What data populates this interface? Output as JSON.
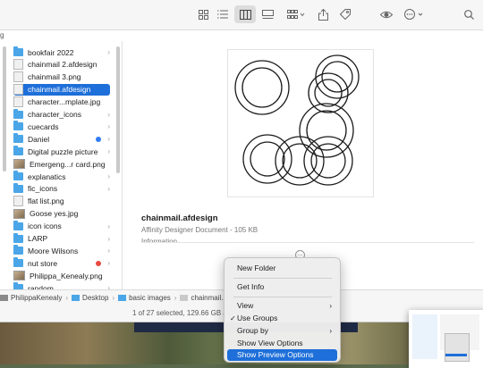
{
  "toolbar": {
    "buttons": [
      {
        "name": "icon-view-button",
        "icon": "grid-icon"
      },
      {
        "name": "list-view-button",
        "icon": "list-icon"
      },
      {
        "name": "column-view-button",
        "icon": "columns-icon",
        "active": true
      },
      {
        "name": "gallery-view-button",
        "icon": "gallery-icon"
      },
      {
        "name": "group-button",
        "icon": "group-grid-icon"
      },
      {
        "name": "share-button",
        "icon": "share-icon"
      },
      {
        "name": "tag-button",
        "icon": "tag-icon"
      },
      {
        "name": "preview-button",
        "icon": "eye-icon"
      },
      {
        "name": "more-actions-button",
        "icon": "ellipsis-circle-icon"
      },
      {
        "name": "search-button",
        "icon": "search-icon"
      }
    ],
    "top_crumb": "g"
  },
  "files": [
    {
      "label": "bookfair 2022",
      "type": "folder",
      "chevron": true
    },
    {
      "label": "chainmail 2.afdesign",
      "type": "file"
    },
    {
      "label": "chainmail 3.png",
      "type": "file"
    },
    {
      "label": "chainmail.afdesign",
      "type": "file",
      "selected": true
    },
    {
      "label": "character...mplate.jpg",
      "type": "file"
    },
    {
      "label": "character_icons",
      "type": "folder",
      "chevron": true
    },
    {
      "label": "cuecards",
      "type": "folder",
      "chevron": true
    },
    {
      "label": "Daniel",
      "type": "folder",
      "chevron": true,
      "tag": "#2f7cf6"
    },
    {
      "label": "Digital puzzle picture",
      "type": "folder",
      "chevron": true
    },
    {
      "label": "Emergeng...r card.png",
      "type": "image"
    },
    {
      "label": "explanatics",
      "type": "folder",
      "chevron": true
    },
    {
      "label": "fic_icons",
      "type": "folder",
      "chevron": true
    },
    {
      "label": "flat list.png",
      "type": "file"
    },
    {
      "label": "Goose yes.jpg",
      "type": "image"
    },
    {
      "label": "icon icons",
      "type": "folder",
      "chevron": true
    },
    {
      "label": "LARP",
      "type": "folder",
      "chevron": true
    },
    {
      "label": "Moore Wilsons",
      "type": "folder",
      "chevron": true
    },
    {
      "label": "nut store",
      "type": "folder",
      "chevron": true,
      "tag": "#e84a3f"
    },
    {
      "label": "Philippa_Kenealy.png",
      "type": "image"
    },
    {
      "label": "random",
      "type": "folder",
      "chevron": true
    }
  ],
  "preview": {
    "filename": "chainmail.afdesign",
    "kind_size": "Affinity Designer Document - 105 KB",
    "info_label": "Information"
  },
  "path": [
    "PhilippaKenealy",
    "Desktop",
    "basic images",
    "chainmail.afdesign"
  ],
  "status": "1 of 27 selected, 129.66 GB av",
  "context_menu": {
    "items": [
      {
        "label": "New Folder"
      },
      {
        "label": "Get Info"
      },
      {
        "label": "View",
        "submenu": true
      },
      {
        "label": "Use Groups",
        "checked": true
      },
      {
        "label": "Group by",
        "submenu": true
      },
      {
        "label": "Show View Options"
      },
      {
        "label": "Show Preview Options",
        "highlighted": true
      }
    ]
  },
  "colors": {
    "accent": "#1e6fd9",
    "folder": "#4aa6e8"
  }
}
